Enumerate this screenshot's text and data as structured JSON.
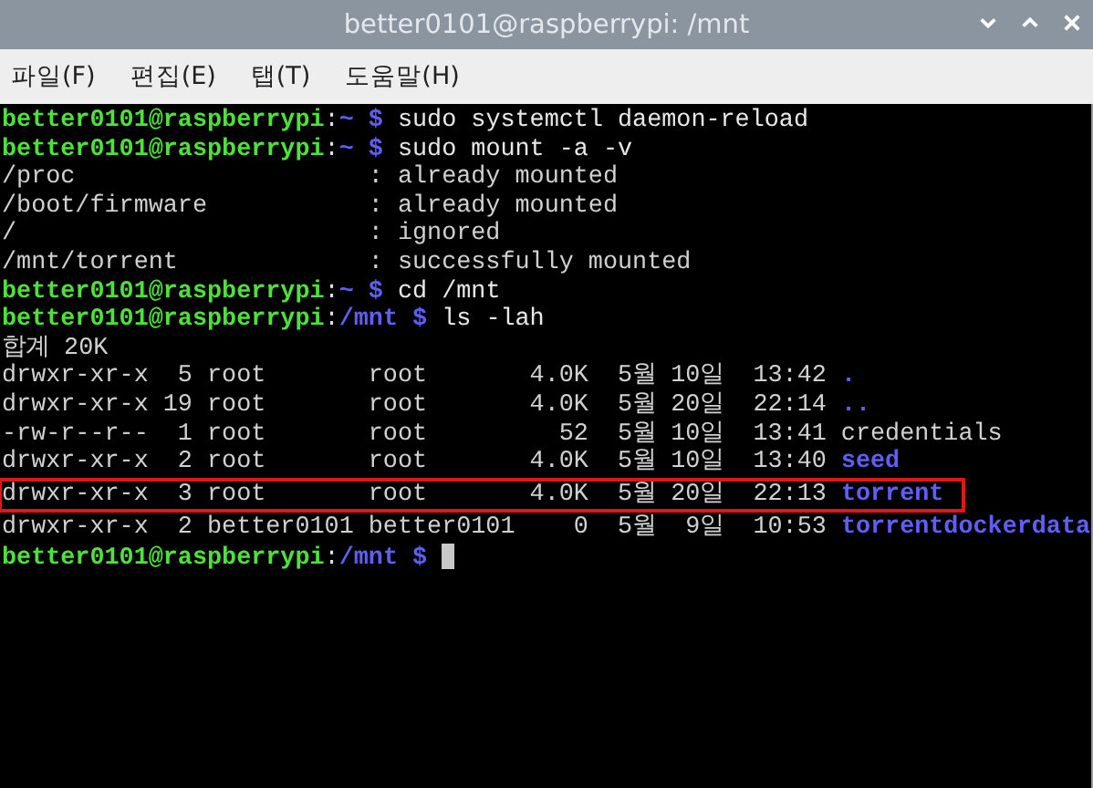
{
  "window": {
    "title": "better0101@raspberrypi: /mnt"
  },
  "menu": [
    {
      "label": "파일(F)"
    },
    {
      "label": "편집(E)"
    },
    {
      "label": "탭(T)"
    },
    {
      "label": "도움말(H)"
    }
  ],
  "terminal": {
    "lines": [
      {
        "segments": [
          {
            "kind": "user",
            "text": "better0101@raspberrypi"
          },
          {
            "kind": "sep",
            "text": ":"
          },
          {
            "kind": "path",
            "text": "~ $"
          },
          {
            "kind": "command",
            "text": " sudo systemctl daemon-reload"
          }
        ]
      },
      {
        "segments": [
          {
            "kind": "user",
            "text": "better0101@raspberrypi"
          },
          {
            "kind": "sep",
            "text": ":"
          },
          {
            "kind": "path",
            "text": "~ $"
          },
          {
            "kind": "command",
            "text": " sudo mount -a -v"
          }
        ]
      },
      {
        "segments": [
          {
            "kind": "output",
            "text": "/proc                    : already mounted"
          }
        ]
      },
      {
        "segments": [
          {
            "kind": "output",
            "text": "/boot/firmware           : already mounted"
          }
        ]
      },
      {
        "segments": [
          {
            "kind": "output",
            "text": "/                        : ignored"
          }
        ]
      },
      {
        "segments": [
          {
            "kind": "output",
            "text": "/mnt/torrent             : successfully mounted"
          }
        ]
      },
      {
        "segments": [
          {
            "kind": "user",
            "text": "better0101@raspberrypi"
          },
          {
            "kind": "sep",
            "text": ":"
          },
          {
            "kind": "path",
            "text": "~ $"
          },
          {
            "kind": "command",
            "text": " cd /mnt"
          }
        ]
      },
      {
        "segments": [
          {
            "kind": "user",
            "text": "better0101@raspberrypi"
          },
          {
            "kind": "sep",
            "text": ":"
          },
          {
            "kind": "path",
            "text": "/mnt $"
          },
          {
            "kind": "command",
            "text": " ls -lah"
          }
        ]
      },
      {
        "segments": [
          {
            "kind": "output",
            "text": "합계 20K"
          }
        ]
      },
      {
        "segments": [
          {
            "kind": "output",
            "text": "drwxr-xr-x  5 root       root       4.0K  5월 10일  13:42 "
          },
          {
            "kind": "dir",
            "text": "."
          }
        ]
      },
      {
        "segments": [
          {
            "kind": "output",
            "text": "drwxr-xr-x 19 root       root       4.0K  5월 20일  22:14 "
          },
          {
            "kind": "dir",
            "text": ".."
          }
        ]
      },
      {
        "segments": [
          {
            "kind": "output",
            "text": "-rw-r--r--  1 root       root         52  5월 10일  13:41 credentials"
          }
        ]
      },
      {
        "segments": [
          {
            "kind": "output",
            "text": "drwxr-xr-x  2 root       root       4.0K  5월 10일  13:40 "
          },
          {
            "kind": "dir",
            "text": "seed"
          }
        ]
      },
      {
        "highlighted": true,
        "segments": [
          {
            "kind": "output",
            "text": "drwxr-xr-x  3 root       root       4.0K  5월 20일  22:13 "
          },
          {
            "kind": "dir",
            "text": "torrent"
          }
        ]
      },
      {
        "segments": [
          {
            "kind": "output",
            "text": "drwxr-xr-x  2 better0101 better0101    0  5월  9일  10:53 "
          },
          {
            "kind": "dir",
            "text": "torrentdockerdata"
          }
        ]
      },
      {
        "cursor": true,
        "segments": [
          {
            "kind": "user",
            "text": "better0101@raspberrypi"
          },
          {
            "kind": "sep",
            "text": ":"
          },
          {
            "kind": "path",
            "text": "/mnt $"
          }
        ]
      }
    ]
  }
}
